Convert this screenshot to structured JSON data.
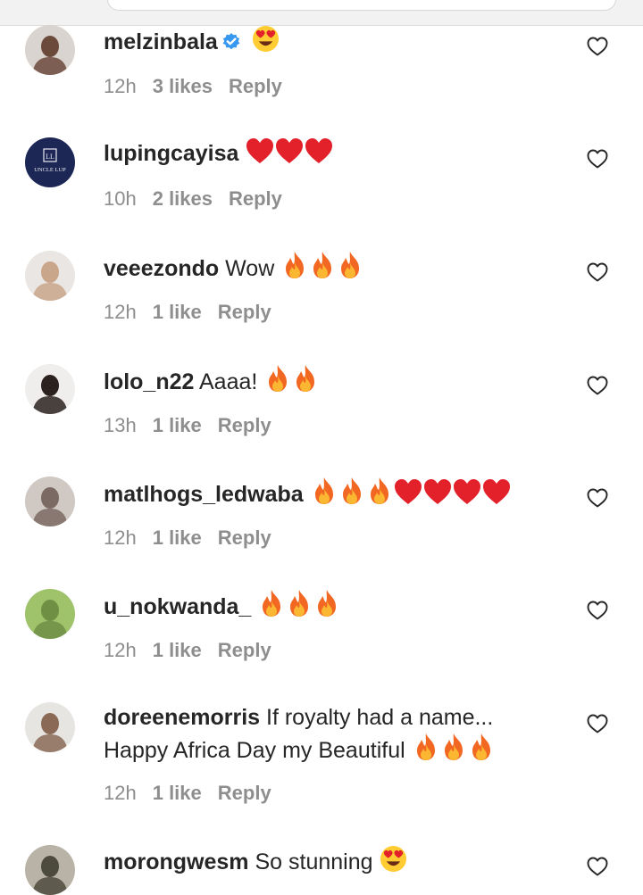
{
  "comments": [
    {
      "username": "melzinbala",
      "verified": true,
      "text": "",
      "emojis": [
        "heart-eyes"
      ],
      "time": "12h",
      "likes": "3 likes",
      "reply": "Reply",
      "avatar_color": "#6b4a3c"
    },
    {
      "username": "lupingcayisa",
      "verified": false,
      "text": "",
      "emojis": [
        "red-heart",
        "red-heart",
        "red-heart"
      ],
      "time": "10h",
      "likes": "2 likes",
      "reply": "Reply",
      "avatar_color": "#1d2755",
      "avatar_logo_text": "UNCLE LUP"
    },
    {
      "username": "veeezondo",
      "verified": false,
      "text": "Wow",
      "emojis": [
        "fire",
        "fire",
        "fire"
      ],
      "time": "12h",
      "likes": "1 like",
      "reply": "Reply",
      "avatar_color": "#c9a58a"
    },
    {
      "username": "lolo_n22",
      "verified": false,
      "text": "Aaaa!",
      "emojis": [
        "fire",
        "fire"
      ],
      "time": "13h",
      "likes": "1 like",
      "reply": "Reply",
      "avatar_color": "#2b2220"
    },
    {
      "username": "matlhogs_ledwaba",
      "verified": false,
      "text": "",
      "emojis": [
        "fire",
        "fire",
        "fire",
        "red-heart",
        "red-heart",
        "red-heart",
        "red-heart"
      ],
      "time": "12h",
      "likes": "1 like",
      "reply": "Reply",
      "avatar_color": "#7b6a63"
    },
    {
      "username": "u_nokwanda_",
      "verified": false,
      "text": "",
      "emojis": [
        "fire",
        "fire",
        "fire"
      ],
      "time": "12h",
      "likes": "1 like",
      "reply": "Reply",
      "avatar_color": "#6f8f45"
    },
    {
      "username": "doreenemorris",
      "verified": false,
      "text": "If royalty had a name... Happy Africa Day my Beautiful",
      "emojis": [
        "fire",
        "fire",
        "fire"
      ],
      "time": "12h",
      "likes": "1 like",
      "reply": "Reply",
      "avatar_color": "#8a6a57"
    },
    {
      "username": "morongwesm",
      "verified": false,
      "text": "So stunning",
      "emojis": [
        "heart-eyes"
      ],
      "time": "",
      "likes": "",
      "reply": "",
      "avatar_color": "#4d4a3e"
    }
  ]
}
